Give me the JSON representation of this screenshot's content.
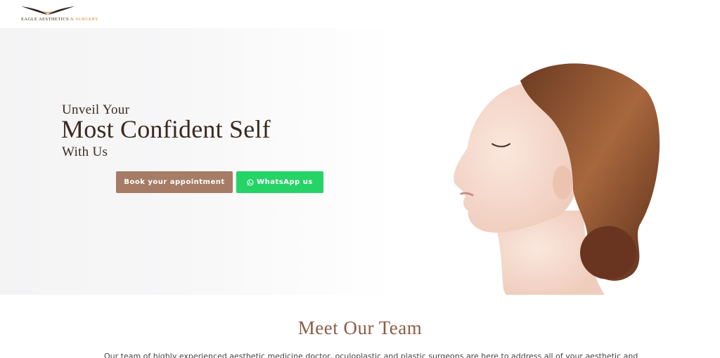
{
  "header": {
    "logo": {
      "brand_text": "EAGLE AESTHETICS",
      "brand_accent": "& SURGERY",
      "icon": "eagle-logo-icon"
    }
  },
  "hero": {
    "line1": "Unveil Your",
    "line2": "Most Confident Self",
    "line3": "With Us",
    "book_button": "Book your appointment",
    "whatsapp_button": "WhatsApp us",
    "whatsapp_icon": "whatsapp-icon",
    "image": "woman-profile-portrait"
  },
  "team": {
    "title": "Meet Our Team",
    "description": "Our team of highly experienced aesthetic medicine doctor, oculoplastic and plastic surgeons are here to address all of your aesthetic and"
  },
  "colors": {
    "brand_brown": "#a67c66",
    "whatsapp_green": "#25d366",
    "heading_dark": "#3b2a20",
    "section_title": "#8b5e45",
    "logo_accent": "#d08a3c"
  }
}
